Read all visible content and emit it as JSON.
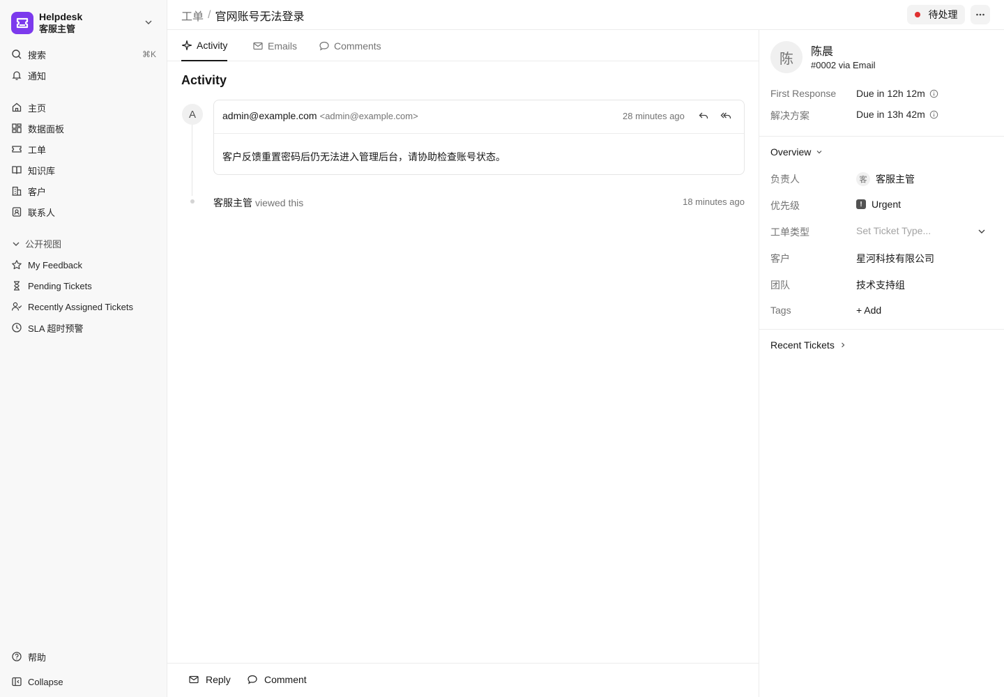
{
  "brand": {
    "name": "Helpdesk",
    "role": "客服主管"
  },
  "sidebar": {
    "search": {
      "label": "搜索",
      "shortcut": "⌘K"
    },
    "notifications": "通知",
    "nav": [
      {
        "label": "主页",
        "icon": "home-icon"
      },
      {
        "label": "数据面板",
        "icon": "dashboard-icon"
      },
      {
        "label": "工单",
        "icon": "ticket-icon"
      },
      {
        "label": "知识库",
        "icon": "book-icon"
      },
      {
        "label": "客户",
        "icon": "building-icon"
      },
      {
        "label": "联系人",
        "icon": "contact-icon"
      }
    ],
    "section_label": "公开视图",
    "views": [
      {
        "label": "My Feedback",
        "icon": "star-icon"
      },
      {
        "label": "Pending Tickets",
        "icon": "hourglass-icon"
      },
      {
        "label": "Recently Assigned Tickets",
        "icon": "user-check-icon"
      },
      {
        "label": "SLA 超时预警",
        "icon": "clock-icon"
      }
    ],
    "help": "帮助",
    "collapse": "Collapse"
  },
  "header": {
    "breadcrumb_parent": "工单",
    "breadcrumb_sep": "/",
    "title": "官网账号无法登录",
    "status": "待处理",
    "status_color": "#e03131"
  },
  "tabs": [
    {
      "label": "Activity",
      "active": true
    },
    {
      "label": "Emails",
      "active": false
    },
    {
      "label": "Comments",
      "active": false
    }
  ],
  "activity": {
    "heading": "Activity",
    "email": {
      "avatar_letter": "A",
      "from_name": "admin@example.com",
      "from_addr": "<admin@example.com>",
      "time": "28 minutes ago",
      "body": "客户反馈重置密码后仍无法进入管理后台，请协助检查账号状态。"
    },
    "view_event": {
      "who": "客服主管",
      "action": "viewed this",
      "time": "18 minutes ago"
    }
  },
  "footer": {
    "reply": "Reply",
    "comment": "Comment"
  },
  "contact": {
    "avatar_char": "陈",
    "name": "陈晨",
    "sub": "#0002 via Email"
  },
  "sla": [
    {
      "label": "First Response",
      "value": "Due in 12h 12m"
    },
    {
      "label": "解决方案",
      "value": "Due in 13h 42m"
    }
  ],
  "overview": {
    "heading": "Overview",
    "fields": {
      "assignee": {
        "label": "负责人",
        "avatar_char": "客",
        "value": "客服主管"
      },
      "priority": {
        "label": "优先级",
        "value": "Urgent"
      },
      "ticket_type": {
        "label": "工单类型",
        "placeholder": "Set Ticket Type..."
      },
      "customer": {
        "label": "客户",
        "value": "星河科技有限公司"
      },
      "team": {
        "label": "团队",
        "value": "技术支持组"
      },
      "tags": {
        "label": "Tags",
        "value": "+ Add"
      }
    }
  },
  "recent_tickets": "Recent Tickets",
  "colors": {
    "brand": "#7c3aed",
    "status_dot": "#e03131"
  }
}
